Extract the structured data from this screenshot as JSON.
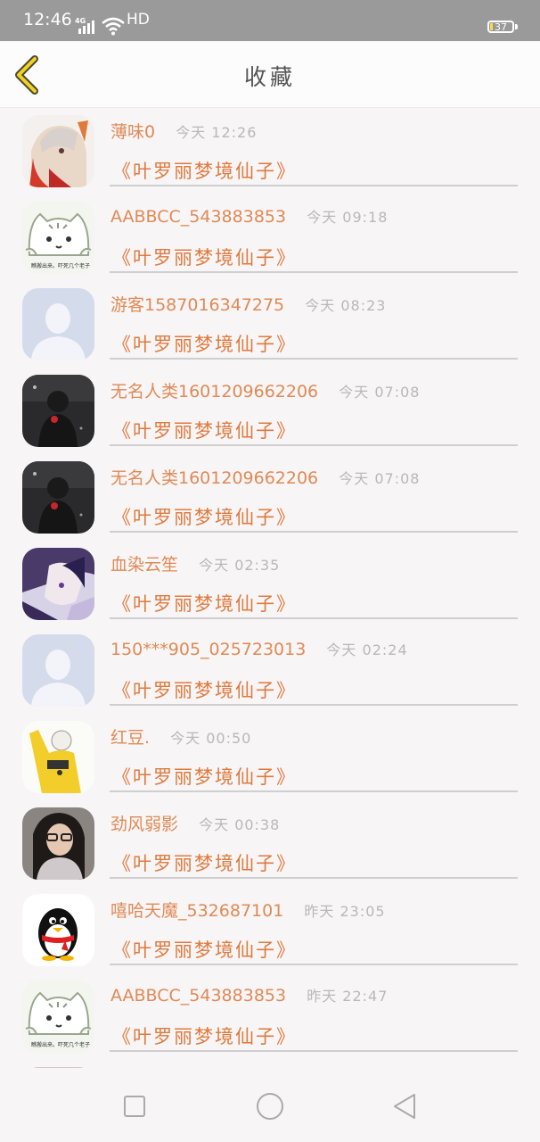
{
  "status_bar": {
    "time": "12:46",
    "network": "4G",
    "hd": "HD",
    "battery": "37"
  },
  "header": {
    "title": "收藏"
  },
  "items": [
    {
      "username": "薄味0",
      "time": "今天 12:26",
      "novel": "《叶罗丽梦境仙子》",
      "avatar": "anime-fox-avatar"
    },
    {
      "username": "AABBCC_543883853",
      "time": "今天 09:18",
      "novel": "《叶罗丽梦境仙子》",
      "avatar": "cat-cartoon-avatar"
    },
    {
      "username": "游客15870163472​75",
      "time": "今天 08:23",
      "novel": "《叶罗丽梦境仙子》",
      "avatar": "default-avatar"
    },
    {
      "username": "无名人类1601209662206",
      "time": "今天 07:08",
      "novel": "《叶罗丽梦境仙子》",
      "avatar": "dark-figure-avatar"
    },
    {
      "username": "无名人类1601209662206",
      "time": "今天 07:08",
      "novel": "《叶罗丽梦境仙子》",
      "avatar": "dark-figure-avatar"
    },
    {
      "username": "血染云笙",
      "time": "今天 02:35",
      "novel": "《叶罗丽梦境仙子》",
      "avatar": "anime-purple-avatar"
    },
    {
      "username": "150***905_025723013",
      "time": "今天 02:24",
      "novel": "《叶罗丽梦境仙子》",
      "avatar": "default-avatar"
    },
    {
      "username": "红豆.",
      "time": "今天 00:50",
      "novel": "《叶罗丽梦境仙子》",
      "avatar": "yellow-hoodie-avatar"
    },
    {
      "username": "劲风弱影",
      "time": "今天 00:38",
      "novel": "《叶罗丽梦境仙子》",
      "avatar": "girl-photo-avatar"
    },
    {
      "username": "嘻哈天魔_532687101",
      "time": "昨天 23:05",
      "novel": "《叶罗丽梦境仙子》",
      "avatar": "qq-penguin-avatar"
    },
    {
      "username": "AABBCC_543883853",
      "time": "昨天 22:47",
      "novel": "《叶罗丽梦境仙子》",
      "avatar": "cat-cartoon-avatar"
    }
  ],
  "nav": {
    "recent": "recent-apps-icon",
    "home": "home-icon",
    "back": "back-icon"
  }
}
